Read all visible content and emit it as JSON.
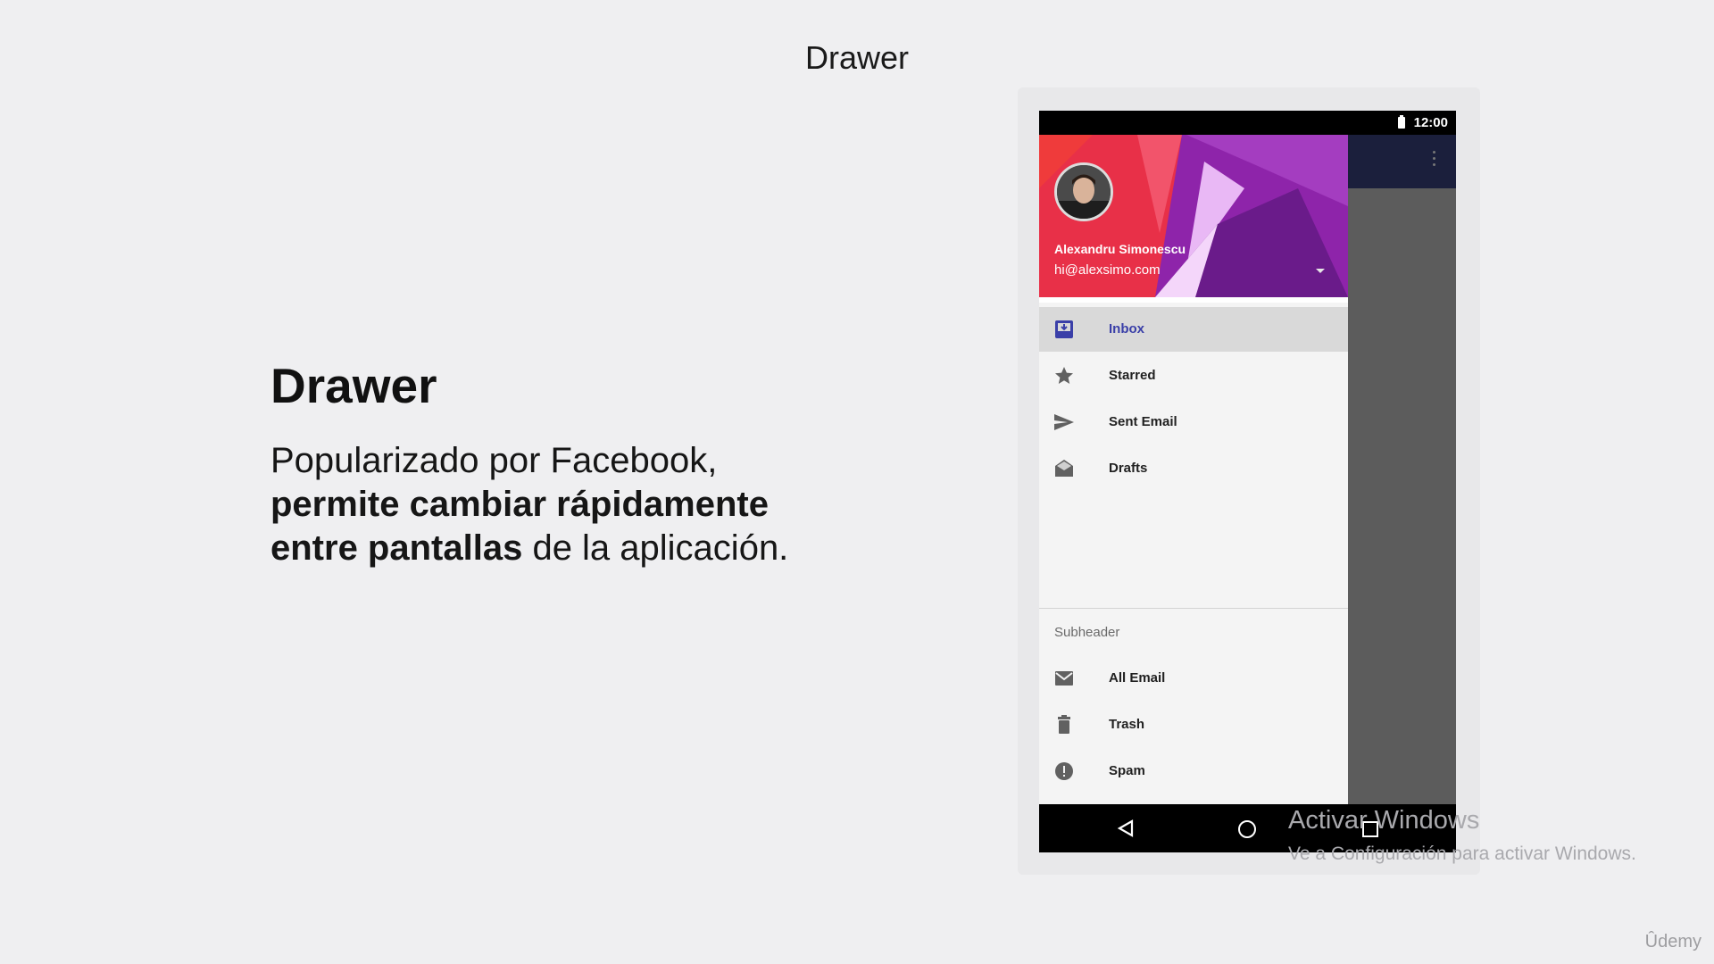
{
  "slide": {
    "title": "Drawer",
    "heading": "Drawer",
    "body": {
      "part1": "Popularizado por Facebook, ",
      "bold": "permite cambiar rápidamente entre pantallas",
      "part2": " de la aplicación."
    }
  },
  "phone": {
    "status_time": "12:00",
    "user": {
      "name": "Alexandru Simonescu",
      "email": "hi@alexsimo.com"
    },
    "nav_items": [
      {
        "label": "Inbox",
        "icon": "inbox-icon",
        "active": true
      },
      {
        "label": "Starred",
        "icon": "star-icon"
      },
      {
        "label": "Sent Email",
        "icon": "send-icon"
      },
      {
        "label": "Drafts",
        "icon": "drafts-icon"
      }
    ],
    "subheader": "Subheader",
    "sub_items": [
      {
        "label": "All Email",
        "icon": "mail-icon"
      },
      {
        "label": "Trash",
        "icon": "trash-icon"
      },
      {
        "label": "Spam",
        "icon": "spam-icon"
      }
    ]
  },
  "watermark": {
    "title": "Activar Windows",
    "subtitle": "Ve a Configuración para activar Windows."
  },
  "brand": "Ûdemy",
  "colors": {
    "accent": "#3a3fa8",
    "app_bar": "#1b1f3c",
    "header_red": "#ef3b3b",
    "header_purple": "#8e24aa"
  }
}
